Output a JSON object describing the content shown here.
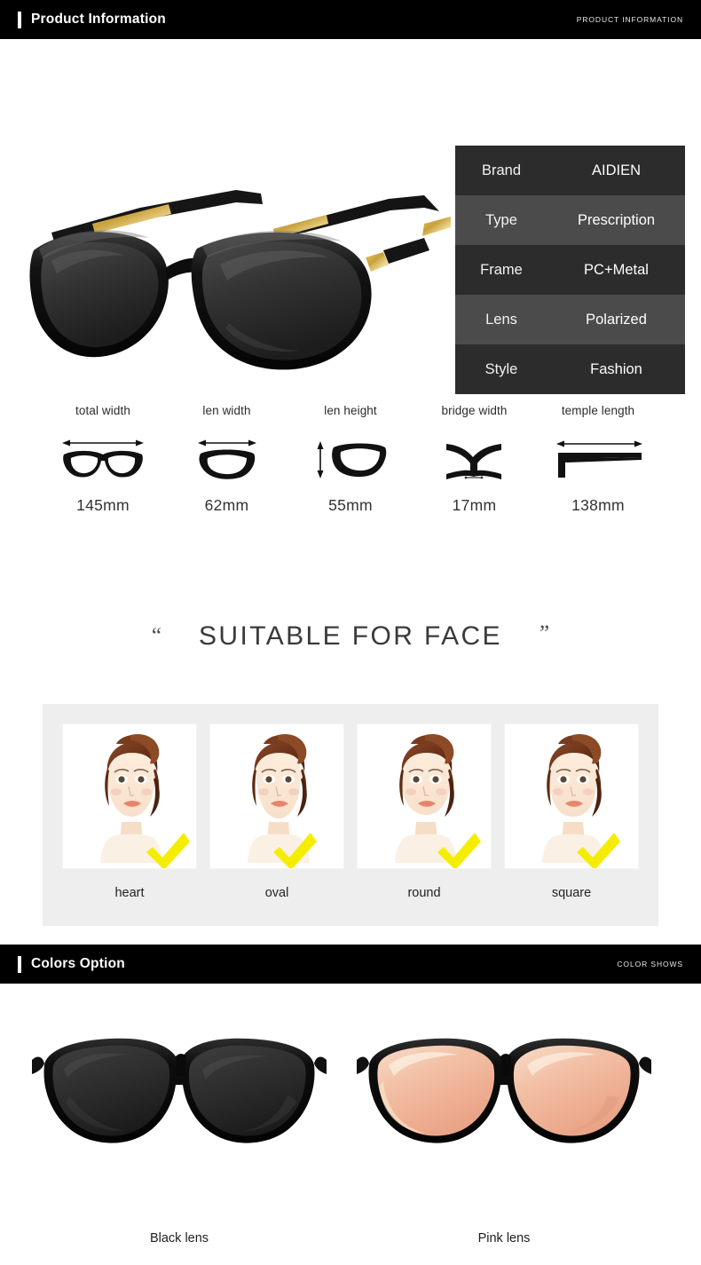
{
  "sections": {
    "product_info": {
      "title": "Product Information",
      "subtitle": "PRODUCT INFORMATION"
    },
    "colors": {
      "title": "Colors Option",
      "subtitle": "COLOR SHOWS"
    }
  },
  "spec_table": {
    "rows": [
      {
        "key": "Brand",
        "value": "AIDIEN"
      },
      {
        "key": "Type",
        "value": "Prescription"
      },
      {
        "key": "Frame",
        "value": "PC+Metal"
      },
      {
        "key": "Lens",
        "value": "Polarized"
      },
      {
        "key": "Style",
        "value": "Fashion"
      }
    ]
  },
  "measurements": [
    {
      "label": "total width",
      "value": "145mm",
      "icon": "full-frame-width-icon"
    },
    {
      "label": "len width",
      "value": "62mm",
      "icon": "lens-width-icon"
    },
    {
      "label": "len height",
      "value": "55mm",
      "icon": "lens-height-icon"
    },
    {
      "label": "bridge width",
      "value": "17mm",
      "icon": "bridge-width-icon"
    },
    {
      "label": "temple length",
      "value": "138mm",
      "icon": "temple-length-icon"
    }
  ],
  "face_section": {
    "quote_open": "“",
    "quote_close": "”",
    "title": "SUITABLE FOR FACE",
    "faces": [
      {
        "label": "heart"
      },
      {
        "label": "oval"
      },
      {
        "label": "round"
      },
      {
        "label": "square"
      }
    ]
  },
  "color_options": [
    {
      "label": "Black lens",
      "lens_color": "#2a2a2a"
    },
    {
      "label": "Pink lens",
      "lens_color": "#f0b9a0"
    }
  ],
  "palette": {
    "bar_background": "#000000",
    "row_dark": "#2c2c2c",
    "row_light": "#4b4b4b",
    "panel_gray": "#eeeeee",
    "check_yellow": "#f5ed00"
  }
}
